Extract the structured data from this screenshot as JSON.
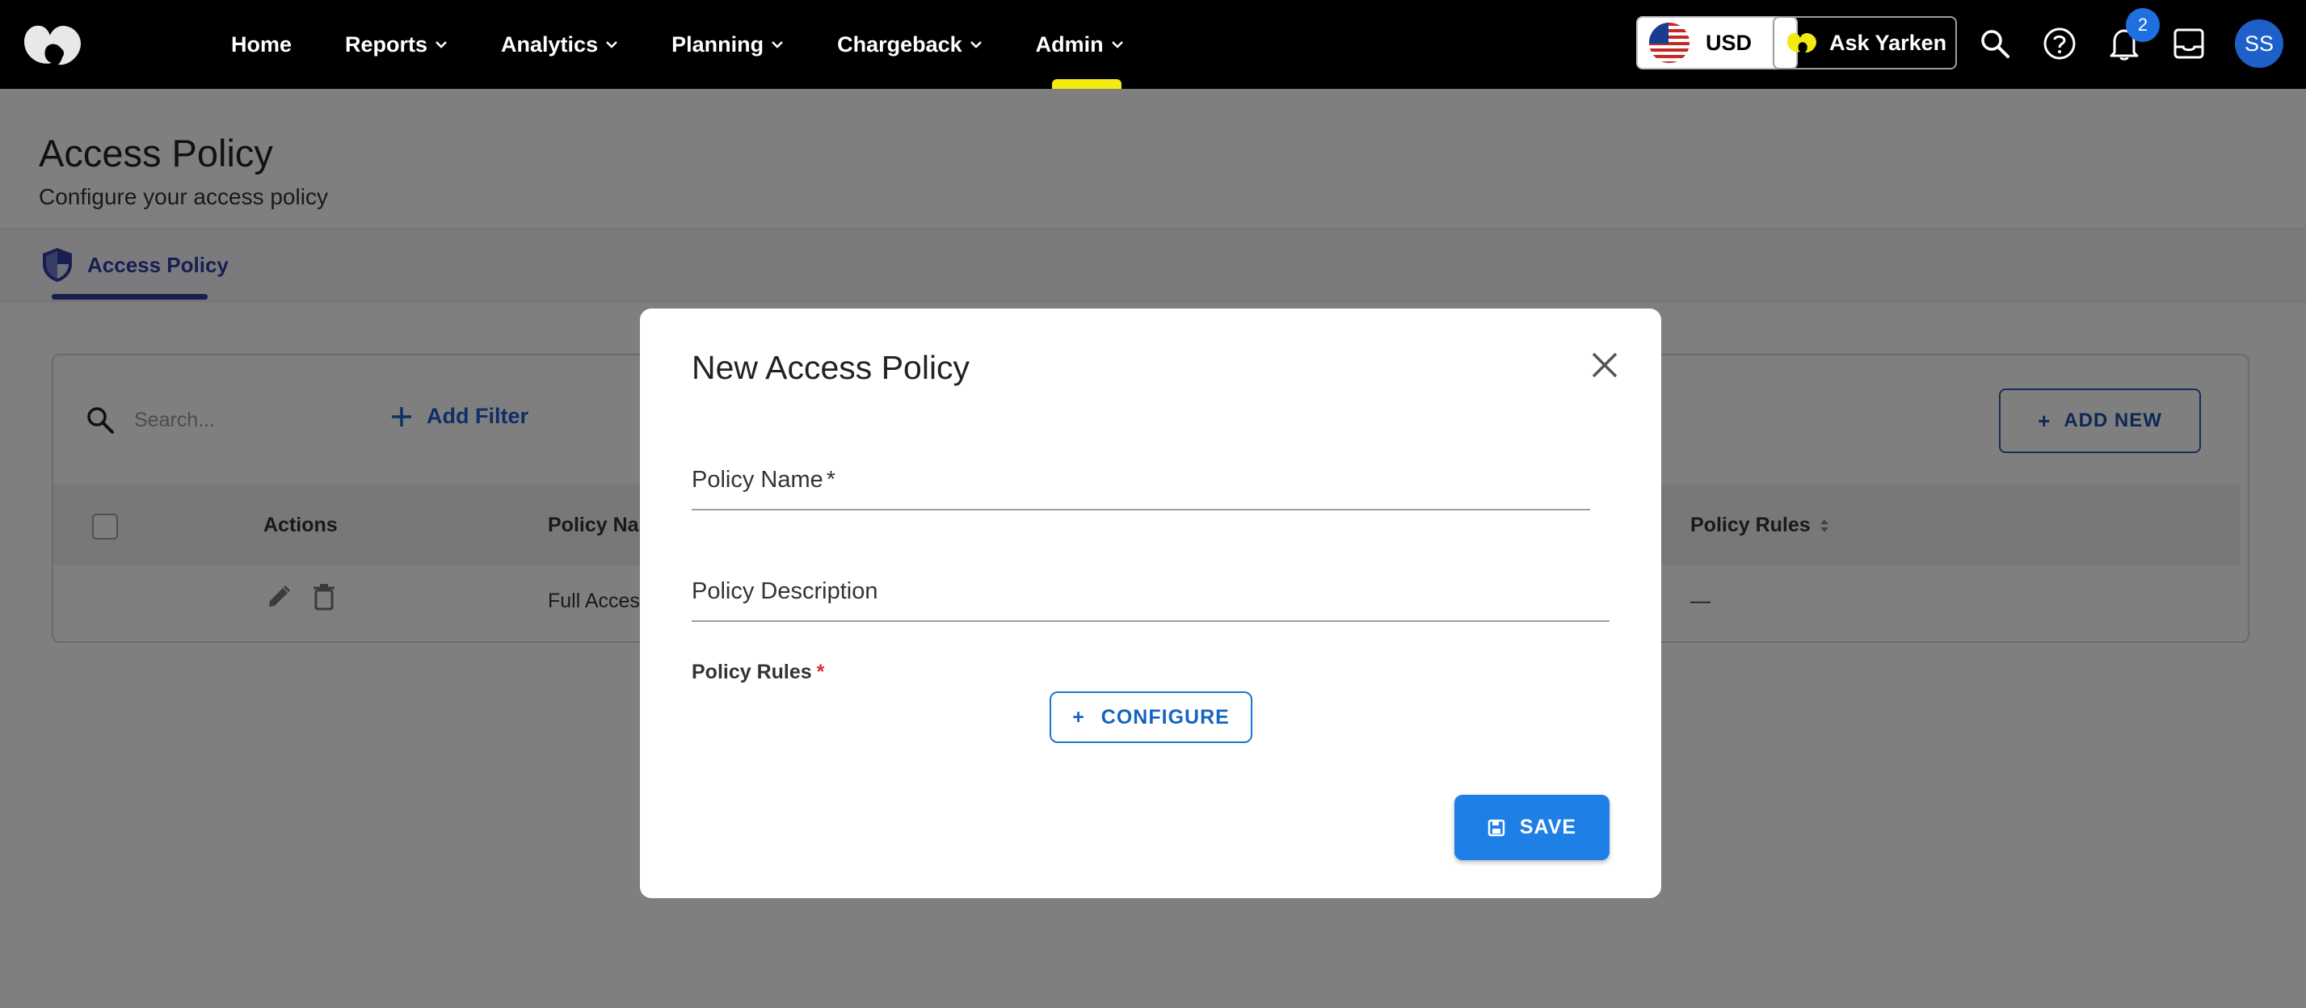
{
  "nav": {
    "items": [
      {
        "label": "Home",
        "has_menu": false
      },
      {
        "label": "Reports",
        "has_menu": true
      },
      {
        "label": "Analytics",
        "has_menu": true
      },
      {
        "label": "Planning",
        "has_menu": true
      },
      {
        "label": "Chargeback",
        "has_menu": true
      },
      {
        "label": "Admin",
        "has_menu": true
      }
    ],
    "active_item": "Admin",
    "active_indicator_color": "#f2ea10"
  },
  "topbar": {
    "currency": "USD",
    "ask_label": "Ask Yarken",
    "notification_count": "2",
    "avatar_initials": "SS",
    "icons": [
      "search-icon",
      "help-icon",
      "bell-icon",
      "inbox-icon"
    ]
  },
  "page": {
    "title": "Access Policy",
    "subtitle": "Configure your access policy"
  },
  "tabs": [
    {
      "label": "Access Policy",
      "icon": "shield-icon",
      "active": true
    }
  ],
  "toolbar": {
    "search_placeholder": "Search...",
    "add_filter_label": "Add Filter",
    "add_new_label": "ADD NEW"
  },
  "table": {
    "columns": [
      "Actions",
      "Policy Nar",
      "Policy Rules"
    ],
    "rows": [
      {
        "policy_name": "Full Acces",
        "policy_rules": "—"
      }
    ]
  },
  "modal": {
    "title": "New Access Policy",
    "policy_name_label": "Policy Name",
    "policy_name_required": "*",
    "policy_description_label": "Policy Description",
    "policy_rules_label": "Policy Rules",
    "policy_rules_required": "*",
    "configure_label": "CONFIGURE",
    "save_label": "SAVE"
  },
  "colors": {
    "primary": "#1e7fe6",
    "tab_accent": "#2c3e9e",
    "topbar": "#000000",
    "required": "#d32f2f"
  }
}
